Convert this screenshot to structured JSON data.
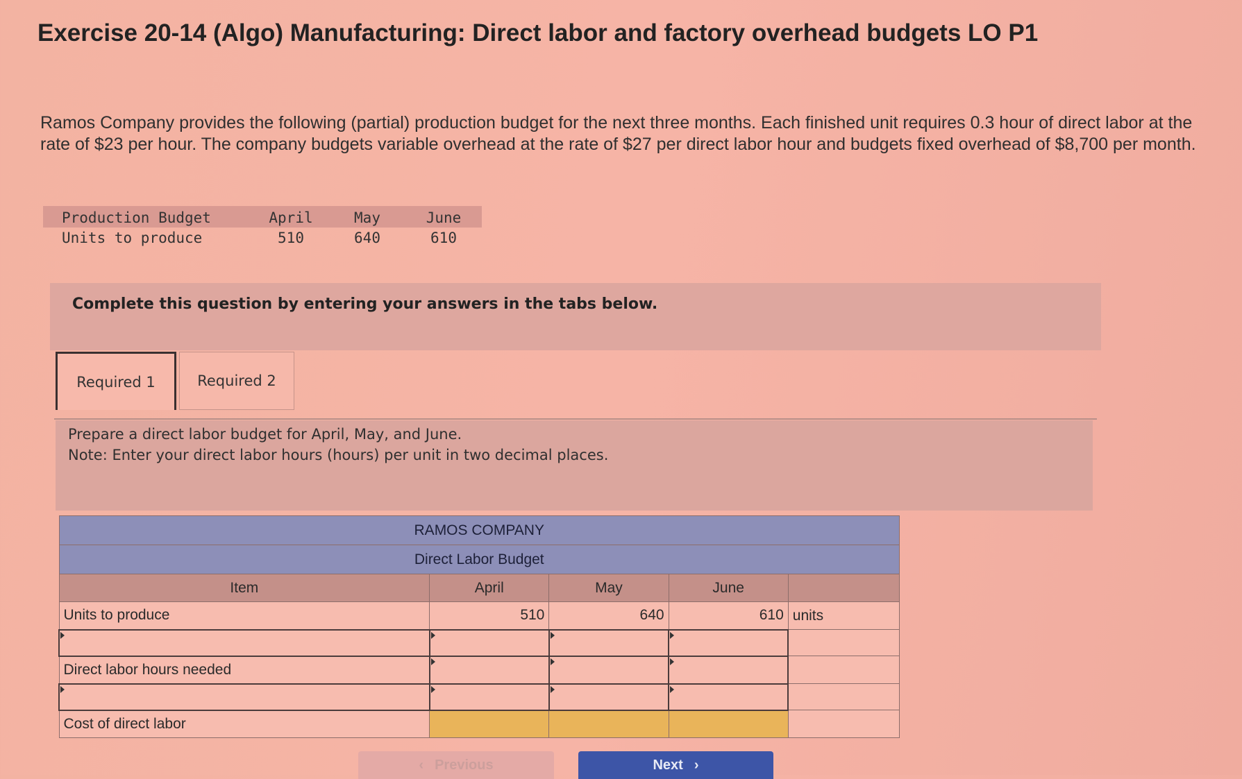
{
  "title": "Exercise 20-14 (Algo) Manufacturing: Direct labor and factory overhead budgets LO P1",
  "intro": "Ramos Company provides the following (partial) production budget for the next three months. Each finished unit requires 0.3 hour of direct labor at the rate of $23 per hour. The company budgets variable overhead at the rate of $27 per direct labor hour and budgets fixed overhead of $8,700 per month.",
  "production_budget": {
    "headers": [
      "Production Budget",
      "April",
      "May",
      "June"
    ],
    "row_label": "Units to produce",
    "values": [
      "510",
      "640",
      "610"
    ]
  },
  "banner": "Complete this question by entering your answers in the tabs below.",
  "tabs": [
    "Required 1",
    "Required 2"
  ],
  "instructions": {
    "line1": "Prepare a direct labor budget for April, May, and June.",
    "line2": "Note: Enter your direct labor hours (hours) per unit in two decimal places."
  },
  "budget": {
    "company": "RAMOS COMPANY",
    "title": "Direct Labor Budget",
    "headers": [
      "Item",
      "April",
      "May",
      "June"
    ],
    "rows": [
      {
        "label": "Units to produce",
        "values": [
          "510",
          "640",
          "610"
        ],
        "unit": "units"
      },
      {
        "label": "",
        "values": [
          "",
          "",
          ""
        ]
      },
      {
        "label": "Direct labor hours needed",
        "values": [
          "",
          "",
          ""
        ]
      },
      {
        "label": "",
        "values": [
          "",
          "",
          ""
        ]
      },
      {
        "label": "Cost of direct labor",
        "values": [
          "",
          "",
          ""
        ]
      }
    ]
  },
  "nav": {
    "prev": "Previous",
    "next": "Next"
  }
}
